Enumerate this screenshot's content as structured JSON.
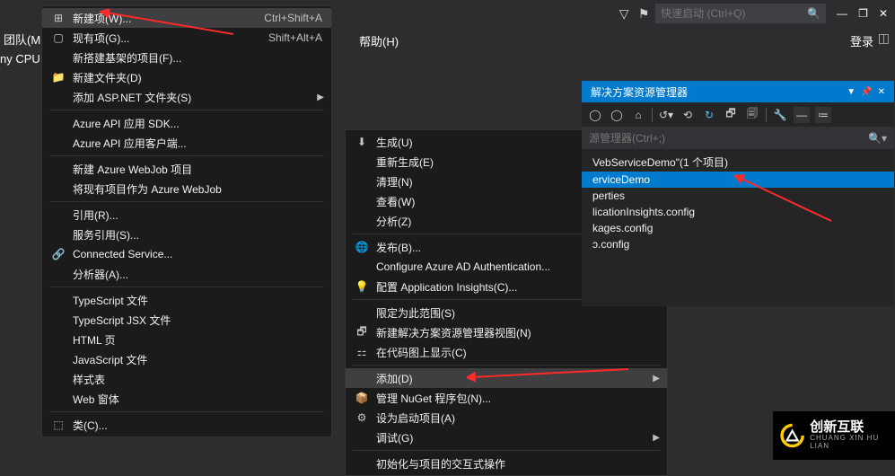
{
  "topbar": {
    "quicklaunch_placeholder": "快速启动 (Ctrl+Q)"
  },
  "header": {
    "help": "帮助(H)",
    "signin": "登录",
    "team": "团队(M",
    "cpu": "ny CPU"
  },
  "menu1": [
    {
      "icon": "new_item",
      "label": "新建项(W)...",
      "shortcut": "Ctrl+Shift+A",
      "selected": true
    },
    {
      "icon": "existing_item",
      "label": "现有项(G)...",
      "shortcut": "Shift+Alt+A"
    },
    {
      "icon": "",
      "label": "新搭建基架的项目(F)..."
    },
    {
      "icon": "new_folder",
      "label": "新建文件夹(D)"
    },
    {
      "icon": "",
      "label": "添加 ASP.NET 文件夹(S)",
      "sub": true
    },
    {
      "sep": true
    },
    {
      "icon": "",
      "label": "Azure API 应用 SDK..."
    },
    {
      "icon": "",
      "label": "Azure API 应用客户端..."
    },
    {
      "sep": true
    },
    {
      "icon": "",
      "label": "新建 Azure WebJob 项目"
    },
    {
      "icon": "",
      "label": "将现有项目作为 Azure WebJob"
    },
    {
      "sep": true
    },
    {
      "icon": "",
      "label": "引用(R)..."
    },
    {
      "icon": "",
      "label": "服务引用(S)..."
    },
    {
      "icon": "connected",
      "label": "Connected Service..."
    },
    {
      "icon": "",
      "label": "分析器(A)..."
    },
    {
      "sep": true
    },
    {
      "icon": "",
      "label": "TypeScript 文件"
    },
    {
      "icon": "",
      "label": "TypeScript JSX 文件"
    },
    {
      "icon": "",
      "label": "HTML 页"
    },
    {
      "icon": "",
      "label": "JavaScript 文件"
    },
    {
      "icon": "",
      "label": "样式表"
    },
    {
      "icon": "",
      "label": "Web 窗体"
    },
    {
      "sep": true
    },
    {
      "icon": "class",
      "label": "类(C)..."
    }
  ],
  "menu2": [
    {
      "icon": "build",
      "label": "生成(U)"
    },
    {
      "icon": "",
      "label": "重新生成(E)"
    },
    {
      "icon": "",
      "label": "清理(N)"
    },
    {
      "icon": "",
      "label": "查看(W)",
      "sub": true
    },
    {
      "icon": "",
      "label": "分析(Z)",
      "sub": true
    },
    {
      "sep": true
    },
    {
      "icon": "publish",
      "label": "发布(B)..."
    },
    {
      "icon": "",
      "label": "Configure Azure AD Authentication..."
    },
    {
      "icon": "appinsights",
      "label": "配置 Application Insights(C)..."
    },
    {
      "sep": true
    },
    {
      "icon": "",
      "label": "限定为此范围(S)"
    },
    {
      "icon": "newview",
      "label": "新建解决方案资源管理器视图(N)"
    },
    {
      "icon": "codemap",
      "label": "在代码图上显示(C)"
    },
    {
      "sep": true
    },
    {
      "icon": "",
      "label": "添加(D)",
      "sub": true,
      "selected": true
    },
    {
      "icon": "nuget",
      "label": "管理 NuGet 程序包(N)..."
    },
    {
      "icon": "gear",
      "label": "设为启动项目(A)"
    },
    {
      "icon": "",
      "label": "调试(G)",
      "sub": true
    },
    {
      "sep": true
    },
    {
      "icon": "",
      "label": "初始化与项目的交互式操作"
    }
  ],
  "solex": {
    "title": "解决方案资源管理器",
    "search_placeholder": "源管理器(Ctrl+;)",
    "tree": [
      {
        "label": "VebServiceDemo\"(1 个项目)"
      },
      {
        "label": "erviceDemo",
        "selected": true
      },
      {
        "label": "perties"
      },
      {
        "label": "licationInsights.config"
      },
      {
        "label": "kages.config"
      },
      {
        "label": "ɔ.config"
      }
    ]
  },
  "logo": {
    "name": "创新互联",
    "sub": "CHUANG XIN HU LIAN"
  }
}
